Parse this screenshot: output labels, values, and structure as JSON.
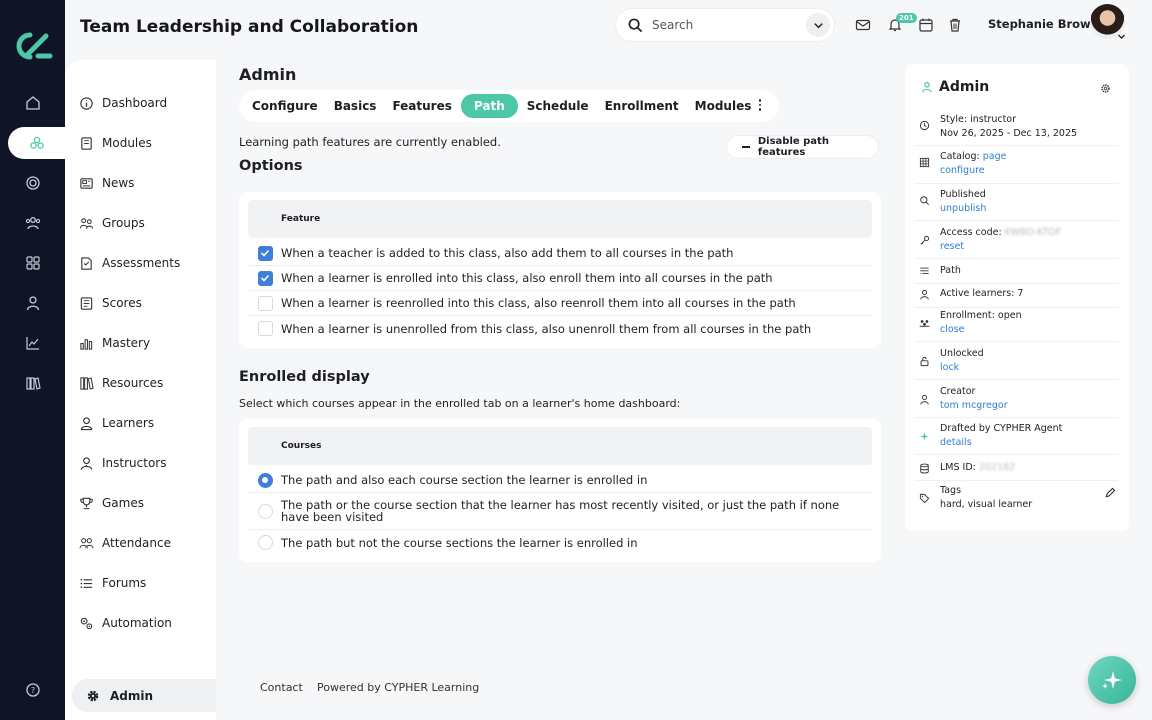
{
  "header": {
    "title": "Team Leadership and Collaboration",
    "search_placeholder": "Search",
    "notification_count": "201",
    "user_name": "Stephanie Brown"
  },
  "rail": {
    "icons": [
      "home-icon",
      "network-icon",
      "target-icon",
      "users-icon",
      "grid-icon",
      "person-icon",
      "chart-icon",
      "library-icon"
    ],
    "help_icon": "help-icon"
  },
  "sidebar": {
    "items": [
      {
        "label": "Dashboard",
        "icon": "info-icon"
      },
      {
        "label": "Modules",
        "icon": "book-icon"
      },
      {
        "label": "News",
        "icon": "news-icon"
      },
      {
        "label": "Groups",
        "icon": "groups-icon"
      },
      {
        "label": "Assessments",
        "icon": "assessment-icon"
      },
      {
        "label": "Scores",
        "icon": "scores-icon"
      },
      {
        "label": "Mastery",
        "icon": "bar-chart-icon"
      },
      {
        "label": "Resources",
        "icon": "books-icon"
      },
      {
        "label": "Learners",
        "icon": "learner-icon"
      },
      {
        "label": "Instructors",
        "icon": "instructor-icon"
      },
      {
        "label": "Games",
        "icon": "trophy-icon"
      },
      {
        "label": "Attendance",
        "icon": "attendance-icon"
      },
      {
        "label": "Forums",
        "icon": "list-icon"
      },
      {
        "label": "Automation",
        "icon": "automation-icon"
      }
    ],
    "admin_label": "Admin"
  },
  "main": {
    "heading": "Admin",
    "tabs": [
      "Configure",
      "Basics",
      "Features",
      "Path",
      "Schedule",
      "Enrollment",
      "Modules"
    ],
    "active_tab": "Path",
    "status_message": "Learning path features are currently enabled.",
    "disable_button": "Disable path features",
    "options": {
      "title": "Options",
      "header": "Feature",
      "rows": [
        {
          "text": "When a teacher is added to this class, also add them to all courses in the path",
          "checked": true
        },
        {
          "text": "When a learner is enrolled into this class, also enroll them into all courses in the path",
          "checked": true
        },
        {
          "text": "When a learner is reenrolled into this class, also reenroll them into all courses in the path",
          "checked": false
        },
        {
          "text": "When a learner is unenrolled from this class, also unenroll them from all courses in the path",
          "checked": false
        }
      ]
    },
    "enrolled": {
      "title": "Enrolled display",
      "description": "Select which courses appear in the enrolled tab on a learner's home dashboard:",
      "header": "Courses",
      "rows": [
        {
          "text": "The path and also each course section the learner is enrolled in",
          "selected": true
        },
        {
          "text": "The path or the course section that the learner has most recently visited, or just the path if none have been visited",
          "selected": false
        },
        {
          "text": "The path but not the course sections the learner is enrolled in",
          "selected": false
        }
      ]
    }
  },
  "footer": {
    "contact": "Contact",
    "powered": "Powered by CYPHER Learning"
  },
  "info_card": {
    "title": "Admin",
    "style": "Style: instructor",
    "dates": "Nov 26, 2025 - Dec 13, 2025",
    "catalog_label": "Catalog:",
    "catalog_link1": "page",
    "catalog_link2": "configure",
    "published": "Published",
    "unpublish": "unpublish",
    "access_label": "Access code:",
    "access_code": "KWBD-KTDF",
    "reset": "reset",
    "path": "Path",
    "active_learners": "Active learners: 7",
    "enrollment": "Enrollment: open",
    "close": "close",
    "unlocked": "Unlocked",
    "lock": "lock",
    "creator_label": "Creator",
    "creator": "tom mcgregor",
    "drafted": "Drafted by CYPHER Agent",
    "details": "details",
    "lms_label": "LMS ID:",
    "lms_id": "202162",
    "tags_label": "Tags",
    "tags": "hard, visual learner"
  },
  "colors": {
    "accent": "#4cc7a7",
    "link": "#2f7fd2",
    "rail": "#0f1426",
    "checkbox": "#3d7fd9"
  }
}
